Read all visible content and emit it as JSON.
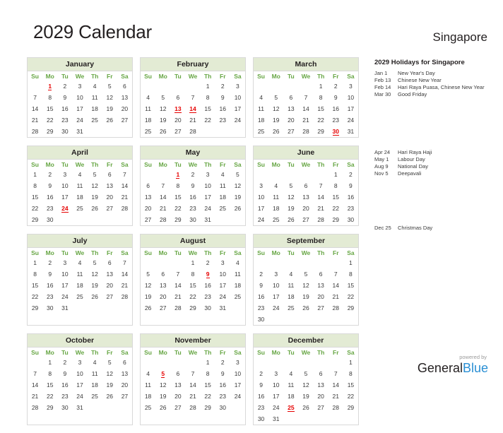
{
  "header": {
    "title": "2029 Calendar",
    "country": "Singapore"
  },
  "colors": {
    "month_header_bg": "#e3ebd4",
    "weekday_green": "#67a644",
    "holiday_red": "#e60000",
    "text": "#231f20",
    "logo_blue": "#2a8fd4",
    "muted": "#9b9b9b"
  },
  "weekdays": [
    "Su",
    "Mo",
    "Tu",
    "We",
    "Th",
    "Fr",
    "Sa"
  ],
  "months": [
    {
      "name": "January",
      "weeks": [
        [
          "",
          "1",
          "2",
          "3",
          "4",
          "5",
          "6"
        ],
        [
          "7",
          "8",
          "9",
          "10",
          "11",
          "12",
          "13"
        ],
        [
          "14",
          "15",
          "16",
          "17",
          "18",
          "19",
          "20"
        ],
        [
          "21",
          "22",
          "23",
          "24",
          "25",
          "26",
          "27"
        ],
        [
          "28",
          "29",
          "30",
          "31",
          "",
          "",
          ""
        ]
      ],
      "holidays": [
        "1"
      ]
    },
    {
      "name": "February",
      "weeks": [
        [
          "",
          "",
          "",
          "",
          "1",
          "2",
          "3"
        ],
        [
          "4",
          "5",
          "6",
          "7",
          "8",
          "9",
          "10"
        ],
        [
          "11",
          "12",
          "13",
          "14",
          "15",
          "16",
          "17"
        ],
        [
          "18",
          "19",
          "20",
          "21",
          "22",
          "23",
          "24"
        ],
        [
          "25",
          "26",
          "27",
          "28",
          "",
          "",
          ""
        ]
      ],
      "holidays": [
        "13",
        "14"
      ]
    },
    {
      "name": "March",
      "weeks": [
        [
          "",
          "",
          "",
          "",
          "1",
          "2",
          "3"
        ],
        [
          "4",
          "5",
          "6",
          "7",
          "8",
          "9",
          "10"
        ],
        [
          "11",
          "12",
          "13",
          "14",
          "15",
          "16",
          "17"
        ],
        [
          "18",
          "19",
          "20",
          "21",
          "22",
          "23",
          "24"
        ],
        [
          "25",
          "26",
          "27",
          "28",
          "29",
          "30",
          "31"
        ]
      ],
      "holidays": [
        "30"
      ]
    },
    {
      "name": "April",
      "weeks": [
        [
          "1",
          "2",
          "3",
          "4",
          "5",
          "6",
          "7"
        ],
        [
          "8",
          "9",
          "10",
          "11",
          "12",
          "13",
          "14"
        ],
        [
          "15",
          "16",
          "17",
          "18",
          "19",
          "20",
          "21"
        ],
        [
          "22",
          "23",
          "24",
          "25",
          "26",
          "27",
          "28"
        ],
        [
          "29",
          "30",
          "",
          "",
          "",
          "",
          ""
        ]
      ],
      "holidays": [
        "24"
      ]
    },
    {
      "name": "May",
      "weeks": [
        [
          "",
          "",
          "1",
          "2",
          "3",
          "4",
          "5"
        ],
        [
          "6",
          "7",
          "8",
          "9",
          "10",
          "11",
          "12"
        ],
        [
          "13",
          "14",
          "15",
          "16",
          "17",
          "18",
          "19"
        ],
        [
          "20",
          "21",
          "22",
          "23",
          "24",
          "25",
          "26"
        ],
        [
          "27",
          "28",
          "29",
          "30",
          "31",
          "",
          ""
        ]
      ],
      "holidays": [
        "1"
      ]
    },
    {
      "name": "June",
      "weeks": [
        [
          "",
          "",
          "",
          "",
          "",
          "1",
          "2"
        ],
        [
          "3",
          "4",
          "5",
          "6",
          "7",
          "8",
          "9"
        ],
        [
          "10",
          "11",
          "12",
          "13",
          "14",
          "15",
          "16"
        ],
        [
          "17",
          "18",
          "19",
          "20",
          "21",
          "22",
          "23"
        ],
        [
          "24",
          "25",
          "26",
          "27",
          "28",
          "29",
          "30"
        ]
      ],
      "holidays": []
    },
    {
      "name": "July",
      "weeks": [
        [
          "1",
          "2",
          "3",
          "4",
          "5",
          "6",
          "7"
        ],
        [
          "8",
          "9",
          "10",
          "11",
          "12",
          "13",
          "14"
        ],
        [
          "15",
          "16",
          "17",
          "18",
          "19",
          "20",
          "21"
        ],
        [
          "22",
          "23",
          "24",
          "25",
          "26",
          "27",
          "28"
        ],
        [
          "29",
          "30",
          "31",
          "",
          "",
          "",
          ""
        ]
      ],
      "holidays": []
    },
    {
      "name": "August",
      "weeks": [
        [
          "",
          "",
          "",
          "1",
          "2",
          "3",
          "4"
        ],
        [
          "5",
          "6",
          "7",
          "8",
          "9",
          "10",
          "11"
        ],
        [
          "12",
          "13",
          "14",
          "15",
          "16",
          "17",
          "18"
        ],
        [
          "19",
          "20",
          "21",
          "22",
          "23",
          "24",
          "25"
        ],
        [
          "26",
          "27",
          "28",
          "29",
          "30",
          "31",
          ""
        ]
      ],
      "holidays": [
        "9"
      ]
    },
    {
      "name": "September",
      "weeks": [
        [
          "",
          "",
          "",
          "",
          "",
          "",
          "1"
        ],
        [
          "2",
          "3",
          "4",
          "5",
          "6",
          "7",
          "8"
        ],
        [
          "9",
          "10",
          "11",
          "12",
          "13",
          "14",
          "15"
        ],
        [
          "16",
          "17",
          "18",
          "19",
          "20",
          "21",
          "22"
        ],
        [
          "23",
          "24",
          "25",
          "26",
          "27",
          "28",
          "29"
        ],
        [
          "30",
          "",
          "",
          "",
          "",
          "",
          ""
        ]
      ],
      "holidays": []
    },
    {
      "name": "October",
      "weeks": [
        [
          "",
          "1",
          "2",
          "3",
          "4",
          "5",
          "6"
        ],
        [
          "7",
          "8",
          "9",
          "10",
          "11",
          "12",
          "13"
        ],
        [
          "14",
          "15",
          "16",
          "17",
          "18",
          "19",
          "20"
        ],
        [
          "21",
          "22",
          "23",
          "24",
          "25",
          "26",
          "27"
        ],
        [
          "28",
          "29",
          "30",
          "31",
          "",
          "",
          ""
        ]
      ],
      "holidays": []
    },
    {
      "name": "November",
      "weeks": [
        [
          "",
          "",
          "",
          "",
          "1",
          "2",
          "3"
        ],
        [
          "4",
          "5",
          "6",
          "7",
          "8",
          "9",
          "10"
        ],
        [
          "11",
          "12",
          "13",
          "14",
          "15",
          "16",
          "17"
        ],
        [
          "18",
          "19",
          "20",
          "21",
          "22",
          "23",
          "24"
        ],
        [
          "25",
          "26",
          "27",
          "28",
          "29",
          "30",
          ""
        ]
      ],
      "holidays": [
        "5"
      ]
    },
    {
      "name": "December",
      "weeks": [
        [
          "",
          "",
          "",
          "",
          "",
          "",
          "1"
        ],
        [
          "2",
          "3",
          "4",
          "5",
          "6",
          "7",
          "8"
        ],
        [
          "9",
          "10",
          "11",
          "12",
          "13",
          "14",
          "15"
        ],
        [
          "16",
          "17",
          "18",
          "19",
          "20",
          "21",
          "22"
        ],
        [
          "23",
          "24",
          "25",
          "26",
          "27",
          "28",
          "29"
        ],
        [
          "30",
          "31",
          "",
          "",
          "",
          "",
          ""
        ]
      ],
      "holidays": [
        "25"
      ]
    }
  ],
  "holidays_panel": {
    "title": "2029 Holidays for Singapore",
    "groups": [
      [
        {
          "date": "Jan 1",
          "name": "New Year's Day"
        },
        {
          "date": "Feb 13",
          "name": "Chinese New Year"
        },
        {
          "date": "Feb 14",
          "name": "Hari Raya Puasa, Chinese New Year"
        },
        {
          "date": "Mar 30",
          "name": "Good Friday"
        }
      ],
      [
        {
          "date": "Apr 24",
          "name": "Hari Raya Haji"
        },
        {
          "date": "May 1",
          "name": "Labour Day"
        },
        {
          "date": "Aug 9",
          "name": "National Day"
        },
        {
          "date": "Nov 5",
          "name": "Deepavali"
        }
      ],
      [
        {
          "date": "Dec 25",
          "name": "Christmas Day"
        }
      ]
    ]
  },
  "footer": {
    "powered_by": "powered by",
    "logo_first": "General",
    "logo_second": "Blue"
  }
}
